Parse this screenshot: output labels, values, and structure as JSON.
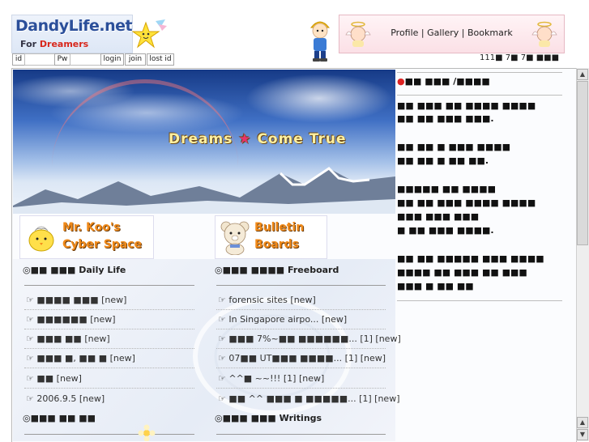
{
  "header": {
    "logo_text": "DandyLife.net",
    "logo_sub_prefix": "For ",
    "logo_sub_highlight": "Dreamers",
    "profile_links": "Profile | Gallery | Bookmark",
    "counter": "111■ 7■ 7■ ■■■"
  },
  "login": {
    "id_label": "id",
    "pw_label": "Pw",
    "login_button": "login",
    "join_button": "join",
    "lost_button": "lost id"
  },
  "banner": {
    "word1": "Dreams",
    "word2": "Come  True"
  },
  "sections": {
    "cyber_line1": "Mr. Koo's",
    "cyber_line2": "Cyber Space",
    "bulletin_line1": "Bulletin",
    "bulletin_line2": "Boards"
  },
  "left_column": {
    "daily": {
      "title_ko": "■■ ■■■",
      "title": "Daily Life",
      "items": [
        {
          "text": "■■■■ ■■■",
          "tag": "[new]"
        },
        {
          "text": "■■■■■■",
          "tag": "[new]"
        },
        {
          "text": "■■■ ■■ ",
          "tag": "[new]"
        },
        {
          "text": "■■■ ■, ■■ ■",
          "tag": "[new]"
        },
        {
          "text": "■■",
          "tag": "[new]"
        },
        {
          "text": "2006.9.5",
          "tag": "[new]"
        }
      ]
    },
    "third": {
      "title_ko": "■■■ ■■ ■■",
      "title": ""
    }
  },
  "right_column": {
    "freeboard": {
      "title_ko": "■■■ ■■■■",
      "title": "Freeboard",
      "items": [
        {
          "text": "forensic sites",
          "tag": "[new]"
        },
        {
          "text": "In Singapore airpo...",
          "tag": "[new]"
        },
        {
          "text": "■■■ 7%~■■ ■■■■■■...",
          "tag": "[1] [new]"
        },
        {
          "text": "07■■ UT■■■ ■■■■...",
          "tag": "[1] [new]"
        },
        {
          "text": "^^■ ~~!!!",
          "tag": "[1] [new]"
        },
        {
          "text": "■■ ^^ ■■■ ■ ■■■■■...",
          "tag": "[1] [new]"
        }
      ]
    },
    "writings": {
      "title_ko": "■■■ ■■■",
      "title": "Writings"
    }
  },
  "sidebar": {
    "heading": "■■ ■■■ /■■■■",
    "lines": [
      "■■ ■■■ ■■ ■■■■ ■■■■",
      "■■ ■■ ■■■ ■■■.",
      "■■ ■■ ■ ■■■ ■■■■",
      "■■ ■■ ■ ■■ ■■.",
      "■■■■■ ■■ ■■■■",
      "■■ ■■ ■■■ ■■■■ ■■■■",
      "■■■ ■■■ ■■■",
      "■ ■■ ■■■ ■■■■.",
      "■■ ■■ ■■■■■ ■■■ ■■■■",
      "■■■■ ■■ ■■■ ■■ ■■■",
      "■■■ ■ ■■ ■■"
    ]
  }
}
